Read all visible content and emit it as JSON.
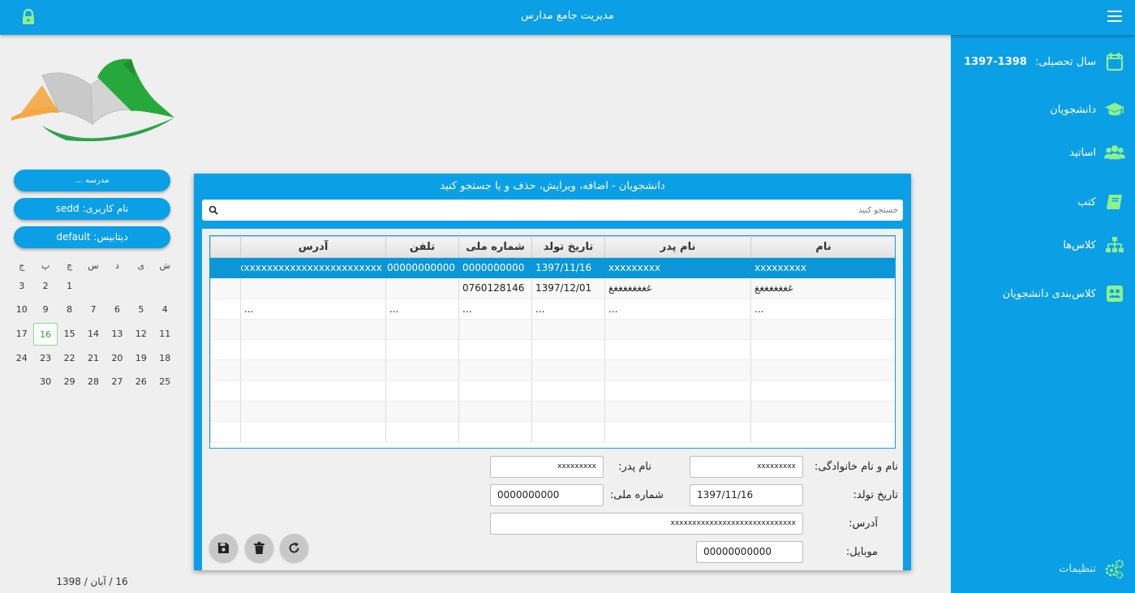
{
  "app": {
    "title": "مدیریت جامع مدارس"
  },
  "sidebar": {
    "year_label": "سال تحصیلی:",
    "year_value": "1397-1398",
    "items": [
      {
        "label": "دانشجویان",
        "icon": "graduation-cap-icon"
      },
      {
        "label": "اساتید",
        "icon": "users-icon"
      },
      {
        "label": "کتب",
        "icon": "book-icon"
      },
      {
        "label": "کلاس‌ها",
        "icon": "sitemap-icon"
      },
      {
        "label": "کلاس‌بندی دانشجویان",
        "icon": "group-icon"
      }
    ],
    "settings_label": "تنظیمات"
  },
  "left": {
    "school": "مدرسه ...",
    "username": "نام کاربری: sedd",
    "database": "دیتابیس: default",
    "calendar": {
      "weekdays": [
        "ش",
        "ی",
        "د",
        "س",
        "چ",
        "پ",
        "ج"
      ],
      "weeks": [
        [
          "",
          "",
          "",
          "",
          "1",
          "2",
          "3"
        ],
        [
          "4",
          "5",
          "6",
          "7",
          "8",
          "9",
          "10"
        ],
        [
          "11",
          "12",
          "13",
          "14",
          "15",
          "16",
          "17"
        ],
        [
          "18",
          "19",
          "20",
          "21",
          "22",
          "23",
          "24"
        ],
        [
          "25",
          "26",
          "27",
          "28",
          "29",
          "30",
          ""
        ]
      ],
      "today": "16"
    },
    "date_footer": "16 / آبان / 1398"
  },
  "card": {
    "title": "دانشجویان - اضافه، ویرایش، حذف و یا جستجو کنید",
    "search_placeholder": "جستجو کنید"
  },
  "table": {
    "headers": [
      "نام",
      "نام پدر",
      "تاریخ تولد",
      "شماره ملی",
      "تلفن",
      "آدرس",
      ""
    ],
    "rows": [
      [
        "xxxxxxxxx",
        "xxxxxxxxx",
        "1397/11/16",
        "0000000000",
        "00000000000",
        "xxxxxxxxxxxxxxxxxxxxxxxxxxxxx",
        ""
      ],
      [
        "غغغغغغغغ",
        "غغغغغغغغغ",
        "1397/12/01",
        "0760128146",
        "",
        "",
        ""
      ],
      [
        "...",
        "...",
        "...",
        "...",
        "...",
        "...",
        ""
      ]
    ],
    "selected_row": 0
  },
  "form": {
    "fullname_label": "نام و نام خانوادگی:",
    "fullname_value": "xxxxxxxxx",
    "father_label": "نام پدر:",
    "father_value": "xxxxxxxxx",
    "birth_label": "تاریخ تولد:",
    "birth_value": "1397/11/16",
    "national_label": "شماره ملی:",
    "national_value": "0000000000",
    "address_label": "آدرس:",
    "address_value": "xxxxxxxxxxxxxxxxxxxxxxxxxxxxx",
    "mobile_label": "موبایل:",
    "mobile_value": "00000000000"
  },
  "actions": [
    {
      "name": "save-button",
      "icon": "save-icon"
    },
    {
      "name": "delete-button",
      "icon": "trash-icon"
    },
    {
      "name": "refresh-button",
      "icon": "refresh-icon"
    }
  ],
  "colors": {
    "primary": "#0b9fe6",
    "icon_accent": "#8ef08e",
    "selected_row": "#0b96d8"
  }
}
